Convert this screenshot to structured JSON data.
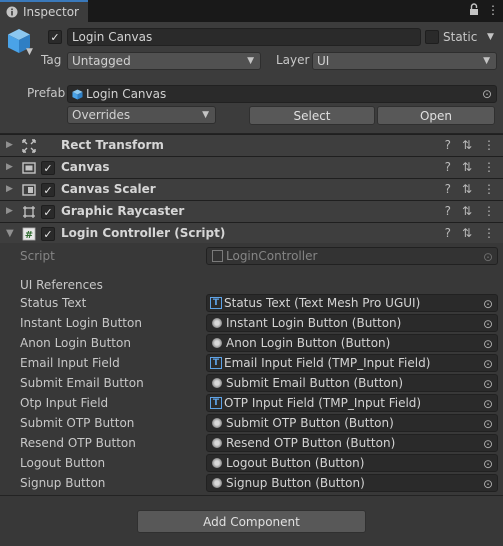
{
  "tab": {
    "title": "Inspector"
  },
  "header": {
    "name": "Login Canvas",
    "static_label": "Static",
    "tag_label": "Tag",
    "tag_value": "Untagged",
    "layer_label": "Layer",
    "layer_value": "UI",
    "prefab_label": "Prefab",
    "prefab_value": "Login Canvas",
    "overrides_label": "Overrides",
    "select_label": "Select",
    "open_label": "Open"
  },
  "components": [
    {
      "title": "Rect Transform",
      "icon": "rect-transform-icon",
      "has_checkbox": false
    },
    {
      "title": "Canvas",
      "icon": "canvas-icon",
      "has_checkbox": true
    },
    {
      "title": "Canvas Scaler",
      "icon": "canvas-scaler-icon",
      "has_checkbox": true
    },
    {
      "title": "Graphic Raycaster",
      "icon": "graphic-raycaster-icon",
      "has_checkbox": true
    },
    {
      "title": "Login Controller (Script)",
      "icon": "script-icon",
      "has_checkbox": true
    }
  ],
  "script": {
    "label": "Script",
    "value": "LoginController",
    "section_header": "UI References",
    "fields": [
      {
        "label": "Status Text",
        "value": "Status Text (Text Mesh Pro UGUI)",
        "icon": "tmp-text-icon"
      },
      {
        "label": "Instant Login Button",
        "value": "Instant Login Button (Button)",
        "icon": "button-icon"
      },
      {
        "label": "Anon Login Button",
        "value": "Anon Login Button (Button)",
        "icon": "button-icon"
      },
      {
        "label": "Email Input Field",
        "value": "Email Input Field (TMP_Input Field)",
        "icon": "tmp-text-icon"
      },
      {
        "label": "Submit Email Button",
        "value": "Submit Email Button (Button)",
        "icon": "button-icon"
      },
      {
        "label": "Otp Input Field",
        "value": "OTP Input Field (TMP_Input Field)",
        "icon": "tmp-text-icon"
      },
      {
        "label": "Submit OTP Button",
        "value": "Submit OTP Button (Button)",
        "icon": "button-icon"
      },
      {
        "label": "Resend OTP Button",
        "value": "Resend OTP Button (Button)",
        "icon": "button-icon"
      },
      {
        "label": "Logout Button",
        "value": "Logout Button (Button)",
        "icon": "button-icon"
      },
      {
        "label": "Signup Button",
        "value": "Signup Button (Button)",
        "icon": "button-icon"
      }
    ]
  },
  "footer": {
    "add_component_label": "Add Component"
  },
  "colors": {
    "accent": "#3a79bb",
    "tmp_icon": "#5fa3e6",
    "cube_icon": "#4aa3e8"
  }
}
